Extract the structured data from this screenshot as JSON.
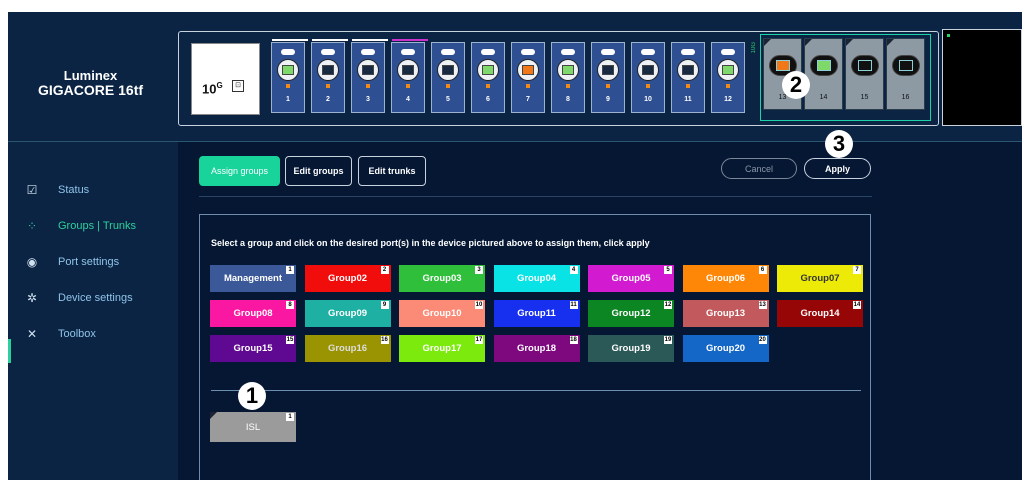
{
  "brand": {
    "line1": "Luminex",
    "line2": "GIGACORE 16tf"
  },
  "device": {
    "speed": "10",
    "speed_sup": "G",
    "sfp_glyph": "⊡",
    "fiber_label": "10G",
    "copper_ports": [
      {
        "num": "1",
        "jack": "#7fd86a",
        "top": "#ffffff"
      },
      {
        "num": "2",
        "jack": "#182a42",
        "top": "#ffffff"
      },
      {
        "num": "3",
        "jack": "#182a42",
        "top": "#ffffff"
      },
      {
        "num": "4",
        "jack": "#182a42",
        "top": "#cc33cc"
      },
      {
        "num": "5",
        "jack": "#182a42",
        "top": ""
      },
      {
        "num": "6",
        "jack": "#7fd86a",
        "top": ""
      },
      {
        "num": "7",
        "jack": "#f07818",
        "top": ""
      },
      {
        "num": "8",
        "jack": "#7fd86a",
        "top": ""
      },
      {
        "num": "9",
        "jack": "#182a42",
        "top": ""
      },
      {
        "num": "10",
        "jack": "#182a42",
        "top": ""
      },
      {
        "num": "11",
        "jack": "#182a42",
        "top": ""
      },
      {
        "num": "12",
        "jack": "#7fd86a",
        "top": ""
      }
    ],
    "fiber_ports": [
      {
        "num": "13",
        "fill": "#f07818"
      },
      {
        "num": "14",
        "fill": "#7fd86a"
      },
      {
        "num": "15",
        "fill": "#111111"
      },
      {
        "num": "16",
        "fill": "#111111"
      }
    ]
  },
  "markers": [
    "1",
    "2",
    "3"
  ],
  "sidebar": {
    "items": [
      {
        "label": "Status",
        "icon": "☑",
        "icon_name": "status-icon"
      },
      {
        "label": "Groups | Trunks",
        "icon": "⁘",
        "icon_name": "groups-icon"
      },
      {
        "label": "Port settings",
        "icon": "◉",
        "icon_name": "port-settings-icon"
      },
      {
        "label": "Device settings",
        "icon": "✲",
        "icon_name": "gear-icon"
      },
      {
        "label": "Toolbox",
        "icon": "✕",
        "icon_name": "tools-icon"
      }
    ]
  },
  "toolbar": {
    "assign": "Assign groups",
    "edit_groups": "Edit groups",
    "edit_trunks": "Edit trunks",
    "cancel": "Cancel",
    "apply": "Apply"
  },
  "panel": {
    "instruction": "Select a group and click on the desired port(s) in the device pictured above to assign them, click apply",
    "groups": [
      {
        "name": "Management",
        "num": "1",
        "color": "#3b5998",
        "text": "#ffffff"
      },
      {
        "name": "Group02",
        "num": "2",
        "color": "#f20d0d",
        "text": "#ffffff"
      },
      {
        "name": "Group03",
        "num": "3",
        "color": "#2fbf3a",
        "text": "#ffffff"
      },
      {
        "name": "Group04",
        "num": "4",
        "color": "#0ae3e6",
        "text": "#ffffff"
      },
      {
        "name": "Group05",
        "num": "5",
        "color": "#d21ad1",
        "text": "#ffffff"
      },
      {
        "name": "Group06",
        "num": "6",
        "color": "#ff8707",
        "text": "#ffffff"
      },
      {
        "name": "Group07",
        "num": "7",
        "color": "#ecea06",
        "text": "#333333"
      },
      {
        "name": "Group08",
        "num": "8",
        "color": "#fa18a2",
        "text": "#ffffff"
      },
      {
        "name": "Group09",
        "num": "9",
        "color": "#1db0a3",
        "text": "#ffffff"
      },
      {
        "name": "Group10",
        "num": "10",
        "color": "#fb8a77",
        "text": "#ffffff"
      },
      {
        "name": "Group11",
        "num": "11",
        "color": "#1730f0",
        "text": "#ffffff"
      },
      {
        "name": "Group12",
        "num": "12",
        "color": "#0c8622",
        "text": "#ffffff"
      },
      {
        "name": "Group13",
        "num": "13",
        "color": "#c25a5d",
        "text": "#ffffff"
      },
      {
        "name": "Group14",
        "num": "14",
        "color": "#960606",
        "text": "#ffffff"
      },
      {
        "name": "Group15",
        "num": "15",
        "color": "#5f0891",
        "text": "#ffffff"
      },
      {
        "name": "Group16",
        "num": "16",
        "color": "#9b9402",
        "text": "#dddddd"
      },
      {
        "name": "Group17",
        "num": "17",
        "color": "#7cea0d",
        "text": "#ffffff"
      },
      {
        "name": "Group18",
        "num": "18",
        "color": "#7e087d",
        "text": "#ffffff"
      },
      {
        "name": "Group19",
        "num": "19",
        "color": "#2b5957",
        "text": "#ffffff"
      },
      {
        "name": "Group20",
        "num": "20",
        "color": "#1466c7",
        "text": "#ffffff"
      }
    ],
    "isl": {
      "name": "ISL",
      "num": "1"
    }
  },
  "colors": {
    "accent": "#18d49b",
    "background": "#061733",
    "panel": "#0b2444"
  }
}
